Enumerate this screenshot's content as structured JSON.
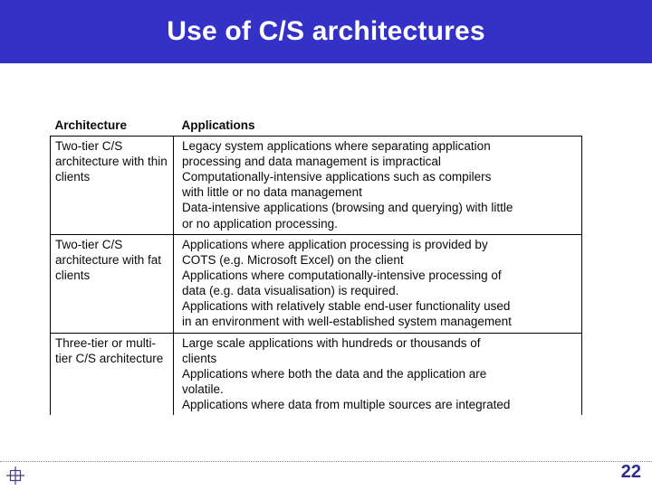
{
  "slide": {
    "title": "Use of C/S architectures",
    "banner_color": "#3431c6",
    "page_number": "22"
  },
  "table": {
    "headers": {
      "architecture": "Architecture",
      "applications": "Applications"
    },
    "rows": [
      {
        "architecture": "Two-tier C/S architecture with thin clients",
        "applications": [
          "Legacy system applications where separating application",
          "processing and data management is impractical",
          "Computationally-intensive applications such as compilers",
          "with little or no data management",
          "Data-intensive applications (browsing and querying) with little",
          "or no application processing."
        ]
      },
      {
        "architecture": "Two-tier C/S architecture with fat clients",
        "applications": [
          "Applications where application processing is provided by",
          "COTS (e.g. Microsoft Excel) on the client",
          "Applications where computationally-intensive processing of",
          "data (e.g. data visualisation) is required.",
          "Applications with relatively stable end-user functionality used",
          "in an environment with well-established system management"
        ]
      },
      {
        "architecture": "Three-tier or multi-tier C/S architecture",
        "applications": [
          "Large scale applications with hundreds or thousands of",
          "clients",
          "Applications where both the data and the application are",
          "volatile.",
          "Applications where data from multiple sources are integrated"
        ]
      }
    ]
  },
  "footer": {
    "registration_mark_icon": "registration-mark-icon"
  }
}
